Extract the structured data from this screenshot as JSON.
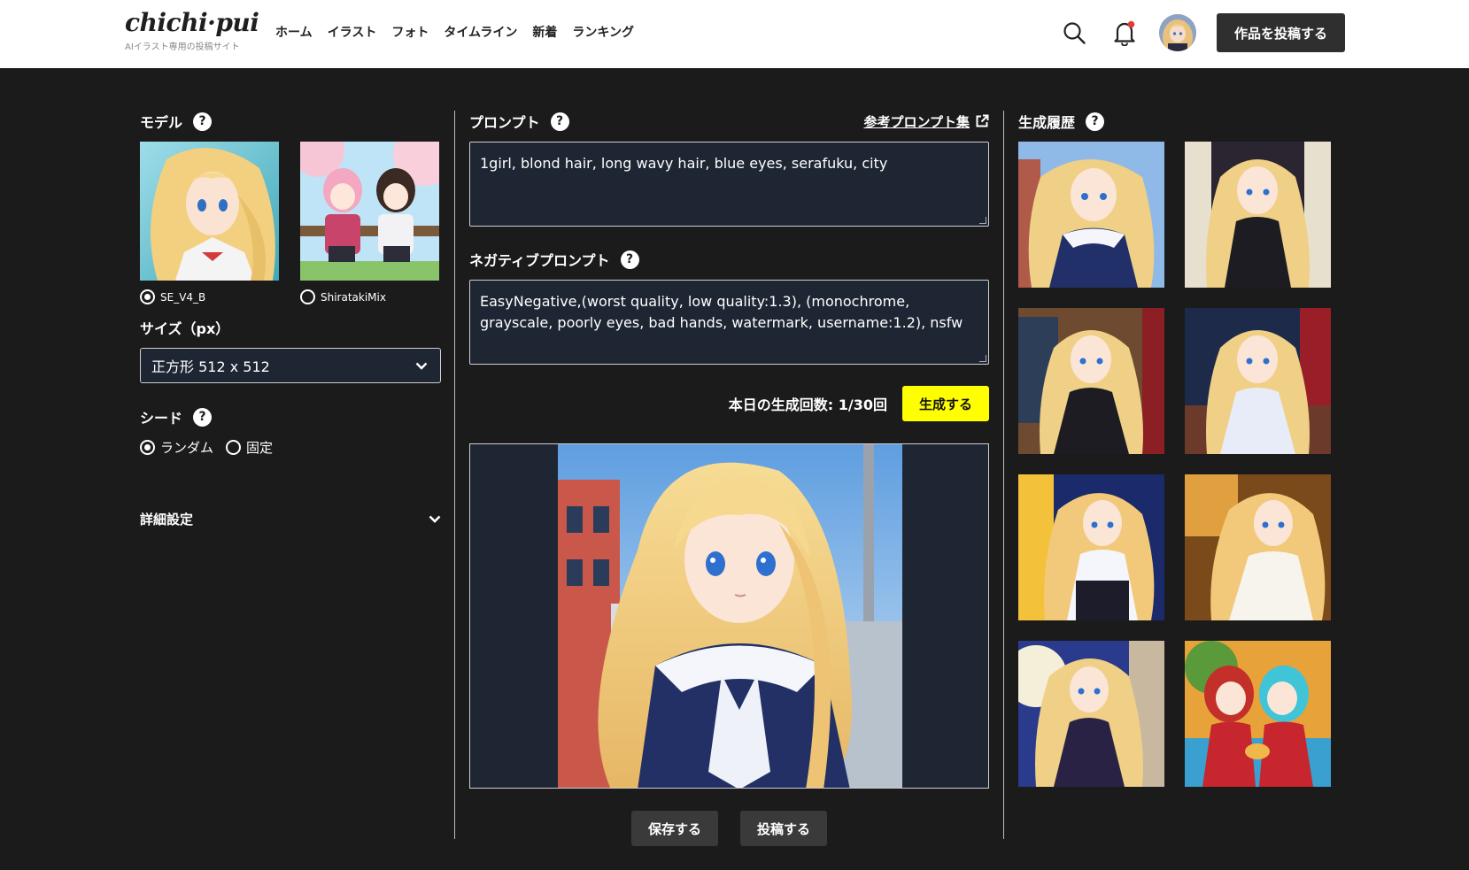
{
  "header": {
    "logo_text": "chichi·pui",
    "logo_tagline": "AIイラスト専用の投稿サイト",
    "nav": [
      "ホーム",
      "イラスト",
      "フォト",
      "タイムライン",
      "新着",
      "ランキング"
    ],
    "post_button": "作品を投稿する",
    "icons": {
      "search": "search-icon",
      "notifications": "bell-icon",
      "avatar": "user-avatar"
    },
    "notification_dot_color": "#e53935"
  },
  "left": {
    "model_title": "モデル",
    "models": [
      {
        "label": "SE_V4_B",
        "selected": true
      },
      {
        "label": "ShiratakiMix",
        "selected": false
      }
    ],
    "size_title": "サイズ（px）",
    "size_value": "正方形 512 x 512",
    "seed_title": "シード",
    "seed_options": [
      {
        "label": "ランダム",
        "selected": true
      },
      {
        "label": "固定",
        "selected": false
      }
    ],
    "advanced_label": "詳細設定"
  },
  "middle": {
    "prompt_title": "プロンプト",
    "ref_link": "参考プロンプト集",
    "prompt_value": "1girl, blond hair, long wavy hair, blue eyes, serafuku, city",
    "negative_title": "ネガティブプロンプト",
    "negative_value": "EasyNegative,(worst quality, low quality:1.3), (monochrome, grayscale, poorly eyes, bad hands, watermark, username:1.2), nsfw",
    "gen_count": "本日の生成回数: 1/30回",
    "generate_button": "生成する",
    "save_button": "保存する",
    "post_button": "投稿する"
  },
  "right": {
    "history_title": "生成履歴"
  },
  "help_glyph": "?",
  "colors": {
    "accent_yellow": "#ffff00",
    "panel_bg": "#1e2633",
    "page_bg": "#1b1b1b"
  }
}
